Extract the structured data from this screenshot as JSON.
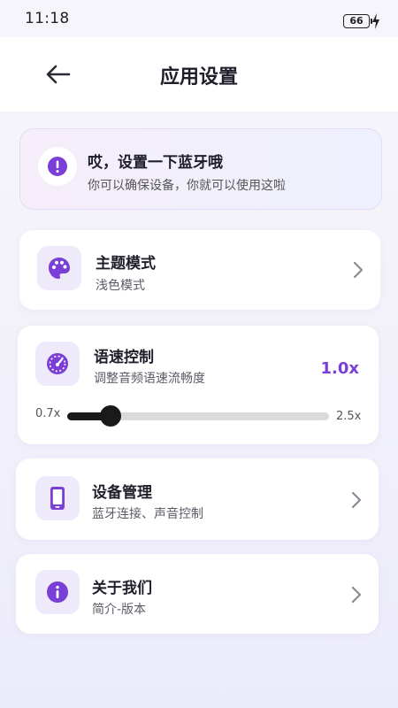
{
  "status_bar": {
    "time": "11:18",
    "battery": "66"
  },
  "header": {
    "title": "应用设置"
  },
  "alert": {
    "title": "哎，设置一下蓝牙哦",
    "subtitle": "你可以确保设备，你就可以使用这啦"
  },
  "settings": {
    "theme": {
      "title": "主题模式",
      "subtitle": "浅色模式"
    },
    "speech_rate": {
      "title": "语速控制",
      "subtitle": "调整音频语速流畅度",
      "value_label": "1.0x",
      "min_label": "0.7x",
      "max_label": "2.5x",
      "min": 0.7,
      "max": 2.5,
      "value": 1.0
    },
    "device": {
      "title": "设备管理",
      "subtitle": "蓝牙连接、声音控制"
    },
    "about": {
      "title": "关于我们",
      "subtitle": "简介-版本"
    }
  },
  "colors": {
    "accent": "#7a3fd6",
    "icon_bg": "#efeaf9",
    "slider_fill": "#1a1a1a",
    "slider_track": "#dadada"
  },
  "icons": {
    "back": "arrow-left-icon",
    "alert": "exclamation-circle-icon",
    "theme": "palette-icon",
    "speed": "speedometer-icon",
    "device": "phone-icon",
    "about": "info-circle-icon",
    "chevron": "chevron-right-icon"
  }
}
